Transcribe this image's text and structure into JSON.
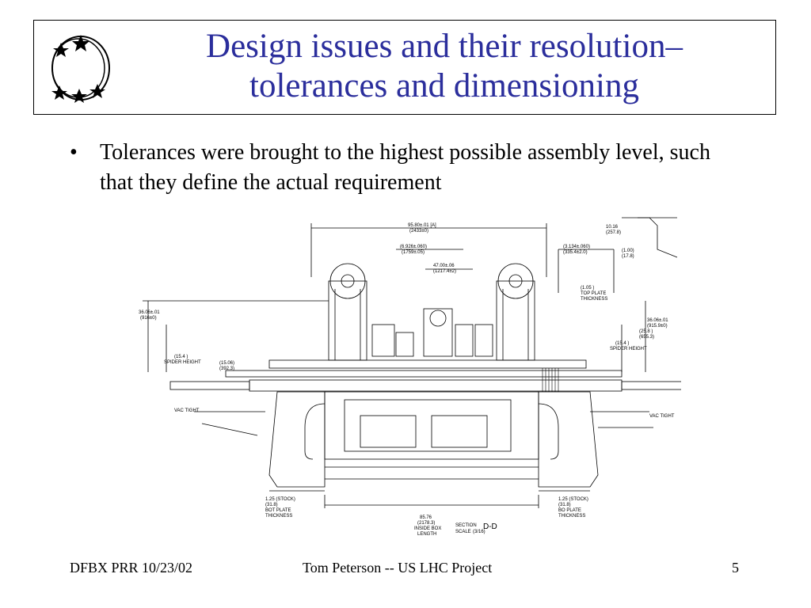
{
  "slide": {
    "title_line1": "Design issues and their resolution–",
    "title_line2": "tolerances and dimensioning",
    "bullets": [
      "Tolerances were brought to the highest possible assembly level, such that they define the actual requirement"
    ]
  },
  "drawing": {
    "section_label": "SECTION",
    "section_id": "D-D",
    "scale_label": "SCALE",
    "scale_value": "(3/16)",
    "callouts": {
      "top_overall": "95.80±.01 [A]",
      "top_overall_sub": "(2433±0)",
      "upper_left": "(6.926±.060)",
      "upper_left_sub": "(1759±.05)",
      "upper_right": "(3.134±.060)",
      "upper_right_sub": "(335.4±2.0)",
      "inner_width": "47.00±.06",
      "inner_width_sub": "(1217.4±2)",
      "left_height": "36.06±.01",
      "left_height_sub": "(916±0)",
      "right_height": "36.06±.01",
      "right_height_sub": "(915.9±0)",
      "top_plate": "(1.05 )",
      "top_plate_sub": "TOP PLATE",
      "top_plate_sub2": "THICKNESS",
      "spider_left": "(15.4 )",
      "spider_left_sub": "SPIDER HEIGHT",
      "spider_right": "(15.4 )",
      "spider_right_sub": "SPIDER HEIGHT",
      "left_mid": "(15.06)",
      "left_mid_sub": "(392.3)",
      "vac_left": "VAC TIGHT",
      "vac_right": "VAC TIGHT",
      "bottom_left": "1.25 (STOCK)",
      "bottom_left_sub": "(31.8)",
      "bottom_left_sub2": "BOT PLATE",
      "bottom_left_sub3": "THICKNESS",
      "bottom_right": "1.25 (STOCK)",
      "bottom_right_sub": "(31.8)",
      "bottom_right_sub2": "BO PLATE",
      "bottom_right_sub3": "THICKNESS",
      "inside_box": "85.76",
      "inside_box_sub": "(2178.3)",
      "inside_box_sub2": "INSIDE BOX",
      "inside_box_sub3": "LENGTH",
      "corner_top": "10.16",
      "corner_top_sub": "(257.8)",
      "corner_mid": "(1.00)",
      "corner_mid_sub": "(17.8)",
      "right_side": "(25.8 )",
      "right_side_sub": "(655.3)"
    }
  },
  "footer": {
    "left": "DFBX PRR  10/23/02",
    "center": "Tom Peterson -- US LHC Project",
    "page_number": "5"
  },
  "colors": {
    "title": "#2b2e9c",
    "ink": "#000000"
  }
}
